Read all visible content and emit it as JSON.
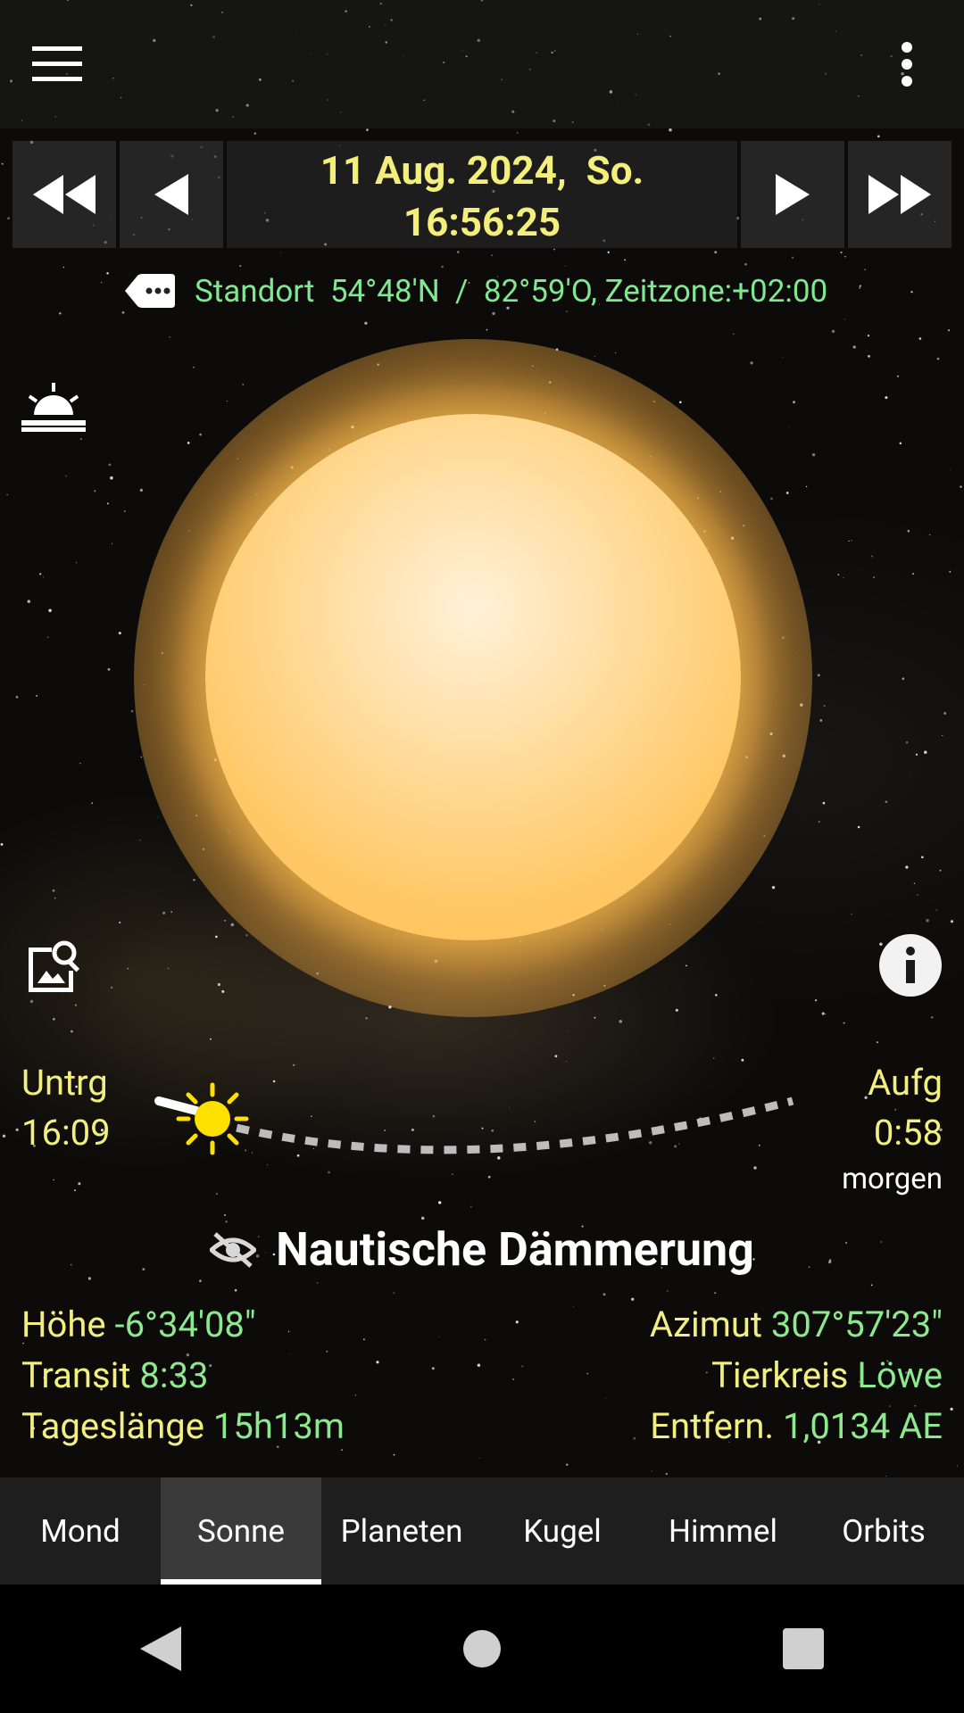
{
  "header": {
    "menu_icon": "hamburger-menu-icon",
    "more_icon": "more-vert-icon"
  },
  "date_nav": {
    "date_line": "11 Aug. 2024,  So.",
    "time_line": "16:56:25",
    "icons": [
      "fast-rewind-icon",
      "step-back-icon",
      "step-forward-icon",
      "fast-forward-icon"
    ]
  },
  "location": {
    "icon": "label-dots-icon",
    "text": "Standort  54°48'N  /  82°59'O, Zeitzone:+02:00"
  },
  "sun_events": {
    "set_label": "Untrg",
    "set_time": "16:09",
    "rise_label": "Aufg",
    "rise_time": "0:58",
    "rise_day": "morgen"
  },
  "twilight": {
    "icon": "eye-off-icon",
    "text": "Nautische Dämmerung"
  },
  "stats_left": [
    {
      "label": "Höhe",
      "value": "-6°34'08\""
    },
    {
      "label": "Transit",
      "value": "8:33"
    },
    {
      "label": "Tageslänge",
      "value": "15h13m"
    }
  ],
  "stats_right": [
    {
      "label": "Azimut",
      "value": "307°57'23\""
    },
    {
      "label": "Tierkreis",
      "value": "Löwe"
    },
    {
      "label": "Entfern.",
      "value": "1,0134 AE"
    }
  ],
  "tabs": [
    {
      "label": "Mond",
      "active": false
    },
    {
      "label": "Sonne",
      "active": true
    },
    {
      "label": "Planeten",
      "active": false
    },
    {
      "label": "Kugel",
      "active": false
    },
    {
      "label": "Himmel",
      "active": false
    },
    {
      "label": "Orbits",
      "active": false
    }
  ],
  "colors": {
    "yellow_text": "#f2ef80",
    "green_text": "#8ee88e",
    "sun": "#ffc866"
  },
  "system_nav": [
    "back-icon",
    "home-icon",
    "recents-icon"
  ]
}
